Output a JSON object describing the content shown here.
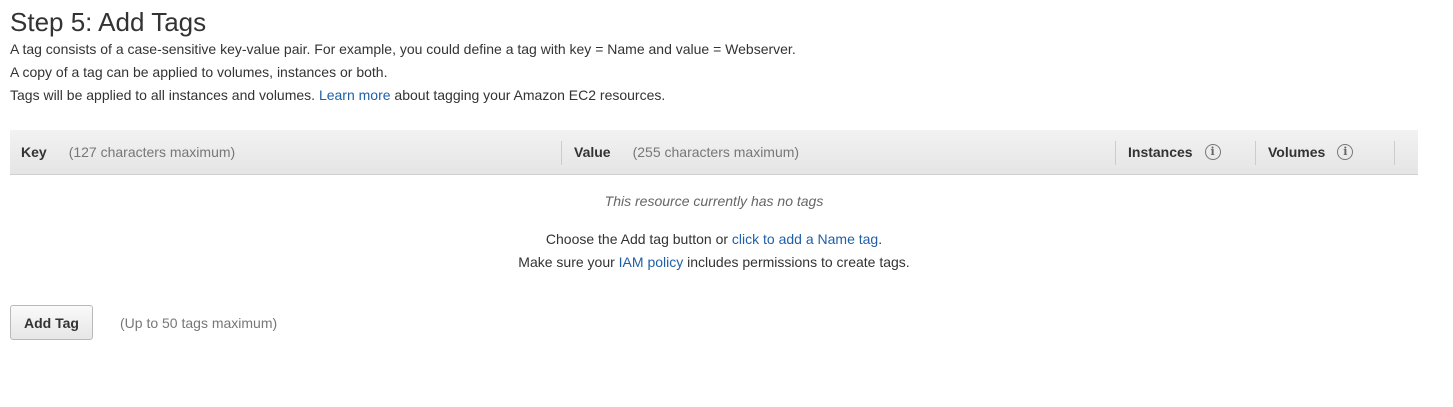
{
  "page": {
    "title": "Step 5: Add Tags"
  },
  "description": {
    "line1": "A tag consists of a case-sensitive key-value pair. For example, you could define a tag with key = Name and value = Webserver.",
    "line2": "A copy of a tag can be applied to volumes, instances or both.",
    "line3_before": "Tags will be applied to all instances and volumes. ",
    "line3_link": "Learn more",
    "line3_after": " about tagging your Amazon EC2 resources."
  },
  "table": {
    "columns": [
      {
        "label": "Key",
        "hint": "(127 characters maximum)"
      },
      {
        "label": "Value",
        "hint": "(255 characters maximum)"
      },
      {
        "label": "Instances",
        "icon": "info-icon"
      },
      {
        "label": "Volumes",
        "icon": "info-icon"
      }
    ],
    "info_glyph": "i",
    "empty_message": "This resource currently has no tags"
  },
  "help": {
    "line1_before": "Choose the Add tag button or ",
    "line1_link": "click to add a Name tag",
    "line1_after": ".",
    "line2_before": "Make sure your ",
    "line2_link": "IAM policy",
    "line2_after": " includes permissions to create tags."
  },
  "actions": {
    "add_tag_label": "Add Tag",
    "limit_hint": "(Up to 50 tags maximum)"
  },
  "colors": {
    "link": "#1f5fa8",
    "text": "#333333",
    "muted": "#777777",
    "header_bg": "#e5e5e5"
  }
}
